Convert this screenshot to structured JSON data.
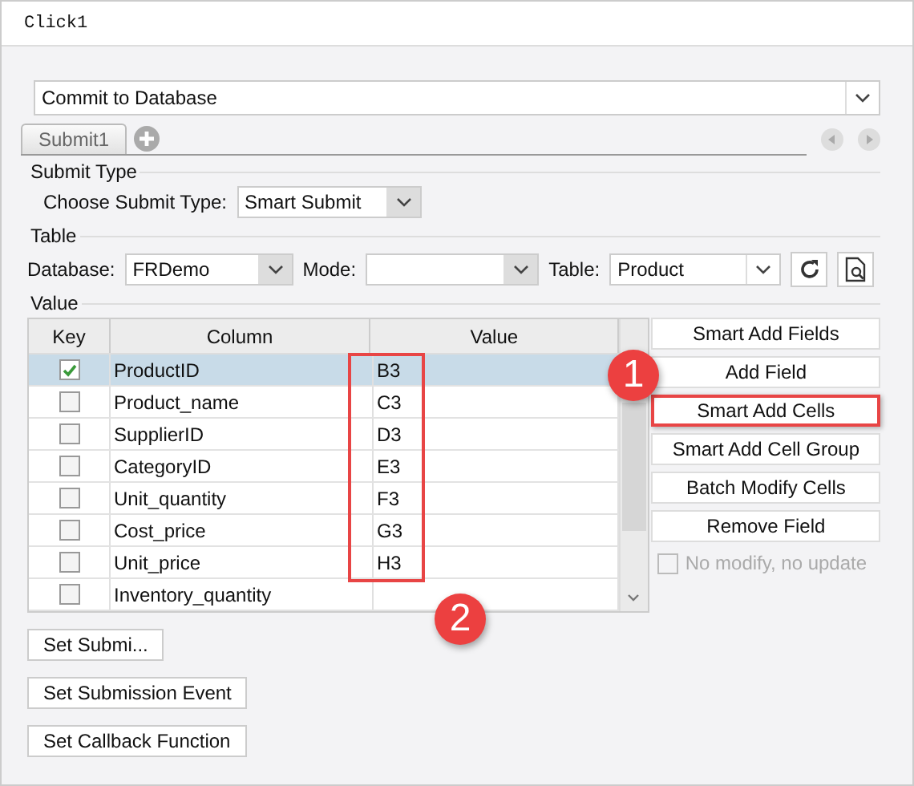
{
  "window": {
    "title": "Click1"
  },
  "action_select": {
    "value": "Commit to Database"
  },
  "tabs": [
    {
      "label": "Submit1",
      "selected": true
    }
  ],
  "submit_type": {
    "heading": "Submit Type",
    "label": "Choose Submit Type:",
    "value": "Smart Submit"
  },
  "table_section": {
    "heading": "Table",
    "database_label": "Database:",
    "database": "FRDemo",
    "mode_label": "Mode:",
    "table_label": "Table:",
    "table": "Product"
  },
  "value_section": {
    "heading": "Value",
    "columns": [
      "Key",
      "Column",
      "Value"
    ],
    "value_frame": true,
    "rows": [
      {
        "key": true,
        "selected": true,
        "column": "ProductID",
        "value": "B3"
      },
      {
        "key": false,
        "selected": false,
        "column": "Product_name",
        "value": "C3"
      },
      {
        "key": false,
        "selected": false,
        "column": "SupplierID",
        "value": "D3"
      },
      {
        "key": false,
        "selected": false,
        "column": "CategoryID",
        "value": "E3"
      },
      {
        "key": false,
        "selected": false,
        "column": "Unit_quantity",
        "value": "F3"
      },
      {
        "key": false,
        "selected": false,
        "column": "Cost_price",
        "value": "G3"
      },
      {
        "key": false,
        "selected": false,
        "column": "Unit_price",
        "value": "H3"
      },
      {
        "key": false,
        "selected": false,
        "column": "Inventory_quantity"
      }
    ]
  },
  "side_buttons": [
    {
      "label": "Smart Add Fields",
      "highlighted": false
    },
    {
      "label": "Add Field",
      "highlighted": false
    },
    {
      "label": "Smart Add Cells",
      "highlighted": true
    },
    {
      "label": "Smart Add Cell Group",
      "highlighted": false
    },
    {
      "label": "Batch Modify Cells",
      "highlighted": false
    },
    {
      "label": "Remove Field",
      "highlighted": false
    }
  ],
  "no_modify": {
    "label": "No modify, no update",
    "checked": false,
    "disabled": true
  },
  "bottom_buttons": [
    "Set Submi...",
    "Set Submission Event",
    "Set Callback Function"
  ],
  "callouts": [
    {
      "label": "1"
    },
    {
      "label": "2"
    }
  ]
}
